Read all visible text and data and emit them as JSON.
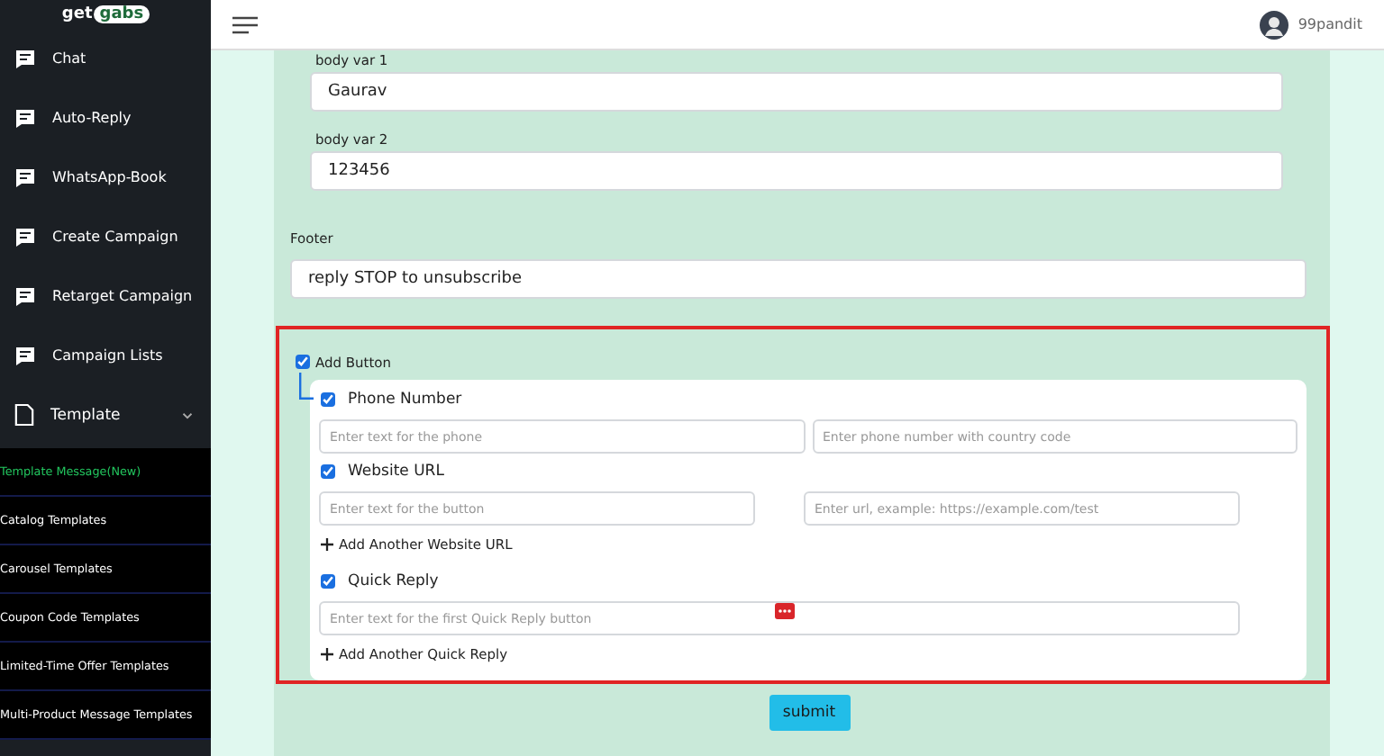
{
  "logo": {
    "part1": "get",
    "part2": "gabs"
  },
  "sidebar": {
    "items": [
      {
        "label": "Chat"
      },
      {
        "label": "Auto-Reply"
      },
      {
        "label": "WhatsApp-Book"
      },
      {
        "label": "Create Campaign"
      },
      {
        "label": "Retarget Campaign"
      },
      {
        "label": "Campaign Lists"
      },
      {
        "label": "Template",
        "kind": "group",
        "expanded": true,
        "children": [
          {
            "label": "Template Message(New)",
            "selected": true
          },
          {
            "label": "Catalog Templates",
            "selected": false
          },
          {
            "label": "Carousel Templates",
            "selected": false
          },
          {
            "label": "Coupon Code Templates",
            "selected": false
          },
          {
            "label": "Limited-Time Offer Templates",
            "selected": false
          },
          {
            "label": "Multi-Product Message Templates",
            "selected": false
          }
        ]
      }
    ]
  },
  "header": {
    "user": "99pandit"
  },
  "form": {
    "body_vars": [
      {
        "label": "body var 1",
        "value": "Gaurav"
      },
      {
        "label": "body var 2",
        "value": "123456"
      }
    ],
    "footer": {
      "label": "Footer",
      "value": "reply STOP to unsubscribe"
    },
    "add_button": {
      "label": "Add Button",
      "checked": true,
      "highlighted": true,
      "sections": [
        {
          "kind": "phone",
          "label": "Phone Number",
          "checked": true,
          "fields": [
            {
              "placeholder": "Enter text for the phone"
            },
            {
              "placeholder": "Enter phone number with country code"
            }
          ]
        },
        {
          "kind": "url",
          "label": "Website URL",
          "checked": true,
          "fields": [
            {
              "placeholder": "Enter text for the button"
            },
            {
              "placeholder": "Enter url, example: https://example.com/test"
            }
          ],
          "add_link": "Add Another Website URL"
        },
        {
          "kind": "quick",
          "label": "Quick Reply",
          "checked": true,
          "fields": [
            {
              "placeholder": "Enter text for the first Quick Reply button",
              "badge": true
            }
          ],
          "add_link": "Add Another Quick Reply"
        }
      ]
    }
  },
  "submit": "submit"
}
